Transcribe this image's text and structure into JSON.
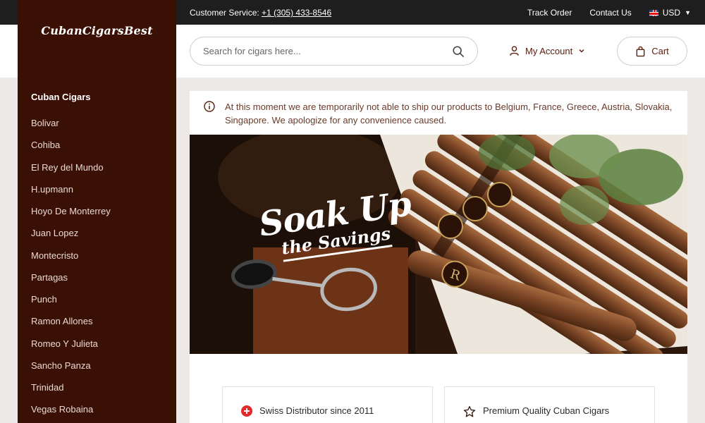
{
  "topbar": {
    "customer_service_label": "Customer Service:",
    "phone": "+1 (305) 433-8546",
    "track_order": "Track Order",
    "contact_us": "Contact Us",
    "currency": "USD"
  },
  "logo": {
    "text": "CubanCigarsBest"
  },
  "header": {
    "search_placeholder": "Search for cigars here...",
    "account_label": "My Account",
    "cart_label": "Cart"
  },
  "sidebar": {
    "title": "Cuban Cigars",
    "items": [
      {
        "label": "Bolivar"
      },
      {
        "label": "Cohiba"
      },
      {
        "label": "El Rey del Mundo"
      },
      {
        "label": "H.upmann"
      },
      {
        "label": "Hoyo De Monterrey"
      },
      {
        "label": "Juan Lopez"
      },
      {
        "label": "Montecristo"
      },
      {
        "label": "Partagas"
      },
      {
        "label": "Punch"
      },
      {
        "label": "Ramon Allones"
      },
      {
        "label": "Romeo Y Julieta"
      },
      {
        "label": "Sancho Panza"
      },
      {
        "label": "Trinidad"
      },
      {
        "label": "Vegas Robaina"
      }
    ]
  },
  "notice": {
    "text": "At this moment we are temporarily not able to ship our products to Belgium, France, Greece, Austria, Slovakia, Singapore. We apologize for any convenience caused."
  },
  "hero": {
    "headline": "Soak Up",
    "subline": "the Savings"
  },
  "features": [
    {
      "label": "Swiss Distributor since 2011"
    },
    {
      "label": "Premium Quality Cuban Cigars"
    }
  ],
  "colors": {
    "sidebar_bg": "#3b1004",
    "accent_text": "#5a2010",
    "topbar_bg": "#1e1e1e"
  }
}
